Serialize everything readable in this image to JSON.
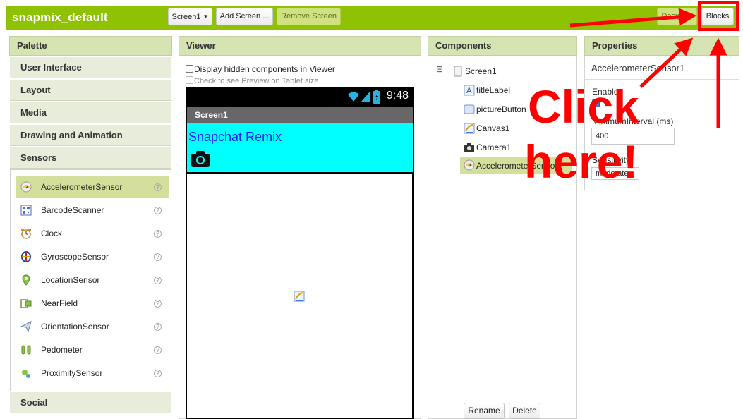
{
  "app": {
    "title": "snapmix_default",
    "screen_select": "Screen1",
    "add_screen": "Add Screen ...",
    "remove_screen": "Remove Screen",
    "designer": "Designer",
    "blocks": "Blocks",
    "accent_color": "#8fc202"
  },
  "palette": {
    "title": "Palette",
    "categories_top": [
      "User Interface",
      "Layout",
      "Media",
      "Drawing and Animation",
      "Sensors"
    ],
    "sensors": [
      {
        "label": "AccelerometerSensor",
        "icon": "accelerometer-icon"
      },
      {
        "label": "BarcodeScanner",
        "icon": "barcode-icon"
      },
      {
        "label": "Clock",
        "icon": "clock-icon"
      },
      {
        "label": "GyroscopeSensor",
        "icon": "gyroscope-icon"
      },
      {
        "label": "LocationSensor",
        "icon": "location-icon"
      },
      {
        "label": "NearField",
        "icon": "nearfield-icon"
      },
      {
        "label": "OrientationSensor",
        "icon": "orientation-icon"
      },
      {
        "label": "Pedometer",
        "icon": "pedometer-icon"
      },
      {
        "label": "ProximitySensor",
        "icon": "proximity-icon"
      }
    ],
    "selected_sensor": "AccelerometerSensor",
    "help_glyph": "?",
    "category_bottom": "Social"
  },
  "viewer": {
    "title": "Viewer",
    "option_hidden": "Display hidden components in Viewer",
    "option_tablet": "Check to see Preview on Tablet size.",
    "time": "9:48",
    "screen_title": "Screen1",
    "label_text": "Snapchat Remix",
    "label_color": "#1a1aff",
    "background_color": "#00ffff"
  },
  "components": {
    "title": "Components",
    "tree": [
      {
        "label": "Screen1",
        "icon": "screen-icon",
        "collapse": "⊟"
      },
      {
        "label": "titleLabel",
        "icon": "label-icon"
      },
      {
        "label": "pictureButton",
        "icon": "button-icon"
      },
      {
        "label": "Canvas1",
        "icon": "canvas-icon"
      },
      {
        "label": "Camera1",
        "icon": "camera-icon"
      },
      {
        "label": "AccelerometerSensor1",
        "icon": "accelerometer-icon"
      }
    ],
    "selected": "AccelerometerSensor1",
    "rename": "Rename",
    "delete": "Delete"
  },
  "properties": {
    "title": "Properties",
    "component_name": "AccelerometerSensor1",
    "enabled_label": "Enabled",
    "enabled_value": true,
    "min_interval_label": "MinimumInterval (ms)",
    "min_interval_value": "400",
    "sensitivity_label": "Sensitivity",
    "sensitivity_value": "moderate"
  },
  "annotation": {
    "line1": "Click",
    "line2": "here!",
    "color": "#ff0000"
  }
}
